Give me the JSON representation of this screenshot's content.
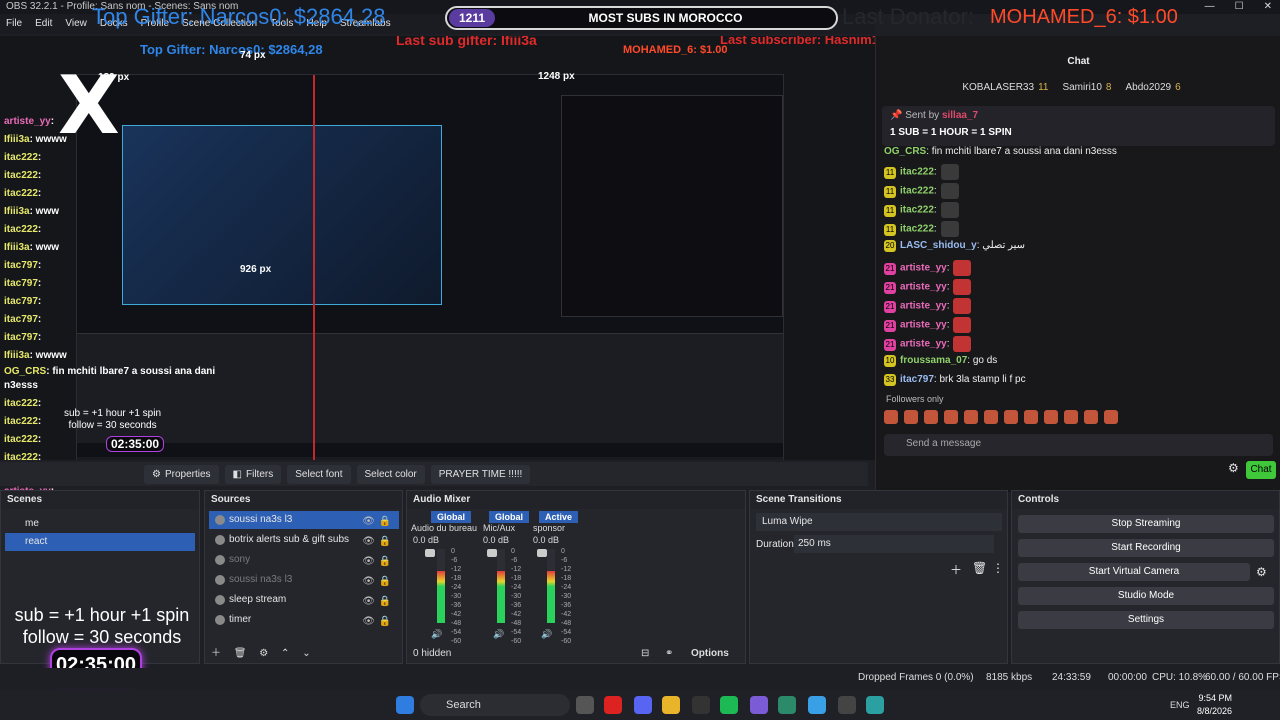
{
  "window": {
    "title": "OBS 32.2.1 - Profile: Sans nom - Scenes: Sans nom"
  },
  "menu": [
    "File",
    "Edit",
    "View",
    "Docks",
    "Profile",
    "Scene Collection",
    "Tools",
    "Help",
    "Streamlabs"
  ],
  "overlay": {
    "top_gifter": "Top Gifter: Narcos0: $2864,28",
    "subs_count": "1211",
    "subs_label": "MOST SUBS IN MOROCCO",
    "last_donator": "Last Donator:",
    "donator_value": "MOHAMED_6: $1.00",
    "last_sub_gifter": "Last sub gifter: Ifiii3a",
    "last_subscriber": "Last subscriber: Hasnim1",
    "mini_top_gifter": "Top Gifter: Narcos0: $2864,28",
    "mini_donator": "MOHAMED_6: $1.00",
    "px_189": "189 px",
    "px_74": "74 px",
    "px_1248": "1248 px",
    "px_926": "926 px",
    "sub_rule": "sub = +1 hour +1 spin",
    "follow_rule": "follow = 30 seconds",
    "timer": "02:35:00"
  },
  "left_chat": [
    {
      "user": "artiste_yy",
      "text": ":"
    },
    {
      "user": "Ifiii3a",
      "text": ": wwww"
    },
    {
      "user": "itac222",
      "text": ":"
    },
    {
      "user": "itac222",
      "text": ":"
    },
    {
      "user": "itac222",
      "text": ":"
    },
    {
      "user": "Ifiii3a",
      "text": ": www"
    },
    {
      "user": "itac222",
      "text": ":"
    },
    {
      "user": "Ifiii3a",
      "text": ": www"
    },
    {
      "user": "itac797",
      "text": ":"
    },
    {
      "user": "itac797",
      "text": ":"
    },
    {
      "user": "itac797",
      "text": ":"
    },
    {
      "user": "itac797",
      "text": ":"
    },
    {
      "user": "itac797",
      "text": ":"
    },
    {
      "user": "Ifiii3a",
      "text": ": wwww"
    },
    {
      "user": "OG_CRS",
      "text": ": fin mchiti lbare7 a soussi ana dani"
    },
    {
      "user": "",
      "text": "n3esss"
    },
    {
      "user": "itac222",
      "text": ":"
    },
    {
      "user": "itac222",
      "text": ":"
    },
    {
      "user": "itac222",
      "text": ":"
    },
    {
      "user": "itac222",
      "text": ":"
    },
    {
      "user": "LASC_shidou_y",
      "text": ": سير تصلي"
    },
    {
      "user": "artiste_yy",
      "text": ":"
    },
    {
      "user": "artiste_yy",
      "text": ":"
    },
    {
      "user": "artiste_yy",
      "text": ":"
    },
    {
      "user": "artiste_yy",
      "text": ":"
    },
    {
      "user": "froussama_07",
      "text": ": go ds"
    },
    {
      "user": "itac797",
      "text": ": brk 3la stamp li f pc"
    }
  ],
  "chat": {
    "title": "Chat",
    "top_users": [
      {
        "name": "KOBALASER33",
        "n": "11"
      },
      {
        "name": "Samiri10",
        "n": "8"
      },
      {
        "name": "Abdo2029",
        "n": "6"
      }
    ],
    "pinned_sent_by": "Sent by",
    "pinned_user": "sillaa_7",
    "pinned_msg": "1 SUB = 1 HOUR = 1 SPIN",
    "messages": [
      {
        "badge": "",
        "user": "OG_CRS",
        "text": ": fin mchiti lbare7 a soussi ana dani n3esss",
        "cls": ""
      },
      {
        "badge": "11",
        "user": "itac222",
        "text": ":",
        "cls": ""
      },
      {
        "badge": "11",
        "user": "itac222",
        "text": ":",
        "cls": ""
      },
      {
        "badge": "11",
        "user": "itac222",
        "text": ":",
        "cls": ""
      },
      {
        "badge": "11",
        "user": "itac222",
        "text": ":",
        "cls": ""
      },
      {
        "badge": "20",
        "user": "LASC_shidou_y",
        "text": ": سير تصلي",
        "cls": "bl"
      },
      {
        "badge": "21",
        "user": "artiste_yy",
        "text": ":",
        "cls": "pk"
      },
      {
        "badge": "21",
        "user": "artiste_yy",
        "text": ":",
        "cls": "pk"
      },
      {
        "badge": "21",
        "user": "artiste_yy",
        "text": ":",
        "cls": "pk"
      },
      {
        "badge": "21",
        "user": "artiste_yy",
        "text": ":",
        "cls": "pk"
      },
      {
        "badge": "21",
        "user": "artiste_yy",
        "text": ":",
        "cls": "pk"
      },
      {
        "badge": "10",
        "user": "froussama_07",
        "text": ": go ds",
        "cls": ""
      },
      {
        "badge": "33",
        "user": "itac797",
        "text": ": brk 3la stamp li f pc",
        "cls": "bl"
      }
    ],
    "followers_only": "Followers only",
    "send_placeholder": "Send a message",
    "chat_button": "Chat"
  },
  "props_bar": {
    "properties": "Properties",
    "filters": "Filters",
    "select_font": "Select font",
    "select_color": "Select color",
    "text_value": "PRAYER TIME !!!!!"
  },
  "scenes": {
    "title": "Scenes",
    "items": [
      "me",
      "react"
    ]
  },
  "sources": {
    "title": "Sources",
    "items": [
      {
        "name": "soussi na3s l3",
        "state": "sel"
      },
      {
        "name": "botrix alerts sub & gift subs",
        "state": ""
      },
      {
        "name": "sony",
        "state": "dim"
      },
      {
        "name": "soussi na3s l3",
        "state": "dim"
      },
      {
        "name": "sleep stream",
        "state": ""
      },
      {
        "name": "timer",
        "state": ""
      }
    ]
  },
  "mixer": {
    "title": "Audio Mixer",
    "global1": "Global",
    "global2": "Global",
    "active": "Active",
    "ch1": "Audio du bureau",
    "ch2": "Mic/Aux",
    "ch3": "sponsor",
    "db1": "0.0 dB",
    "db2": "0.0 dB",
    "db3": "0.0 dB",
    "hidden": "0 hidden",
    "options": "Options",
    "scale": [
      "0",
      "-6",
      "-12",
      "-18",
      "-24",
      "-30",
      "-36",
      "-42",
      "-48",
      "-54",
      "-60"
    ]
  },
  "transitions": {
    "title": "Scene Transitions",
    "selected": "Luma Wipe",
    "duration_label": "Duration",
    "duration_value": "250 ms"
  },
  "controls": {
    "title": "Controls",
    "buttons": [
      "Stop Streaming",
      "Start Recording",
      "Start Virtual Camera",
      "Studio Mode",
      "Settings"
    ]
  },
  "status": {
    "dropped": "Dropped Frames 0 (0.0%)",
    "kbps": "8185 kbps",
    "live": "24:33:59",
    "rec": "00:00:00",
    "cpu": "CPU: 10.8%",
    "fps": "60.00 / 60.00 FPS"
  },
  "taskbar": {
    "search": "Search",
    "lang": "ENG",
    "time": "9:54 PM",
    "date": "8/8/2026"
  }
}
